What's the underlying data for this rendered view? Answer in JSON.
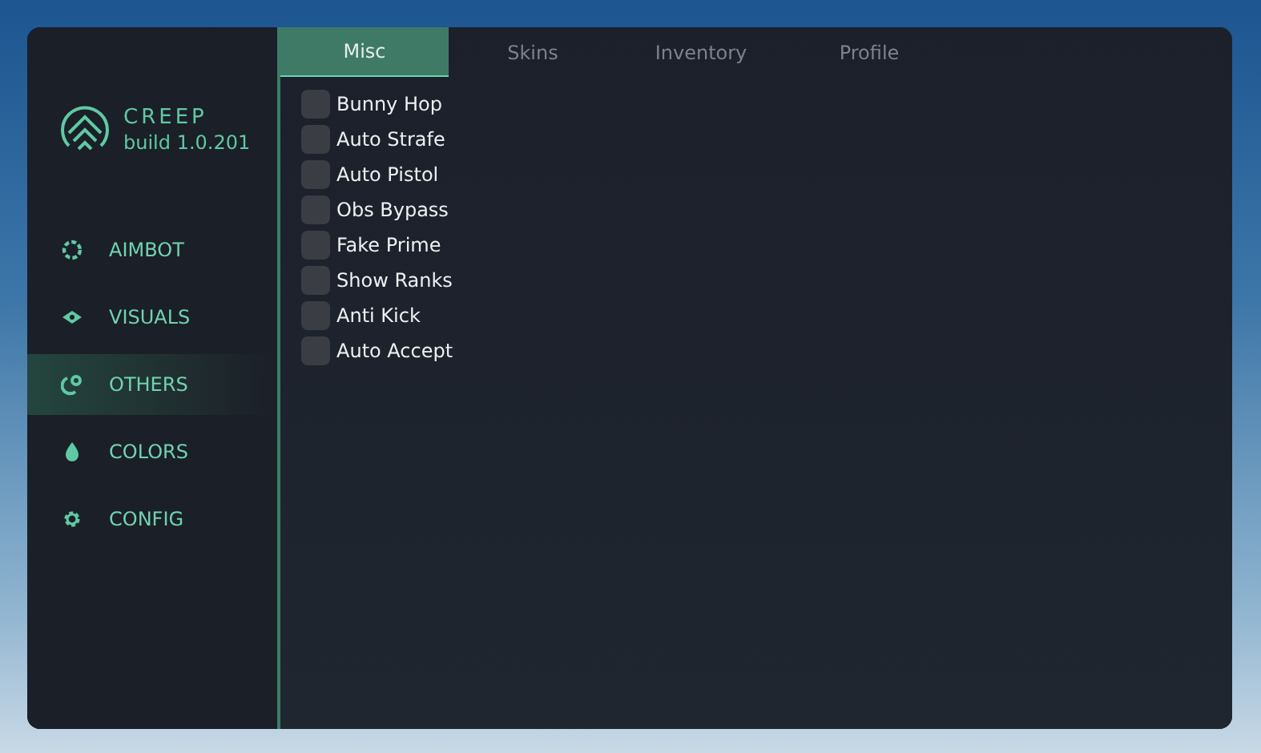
{
  "brand": {
    "name": "CREEP",
    "build": "build 1.0.201"
  },
  "sidebar": {
    "items": [
      {
        "label": "AIMBOT",
        "kind": "crosshair",
        "selected": false
      },
      {
        "label": "VISUALS",
        "kind": "eye",
        "selected": false
      },
      {
        "label": "OTHERS",
        "kind": "others",
        "selected": true
      },
      {
        "label": "COLORS",
        "kind": "drop",
        "selected": false
      },
      {
        "label": "CONFIG",
        "kind": "gear",
        "selected": false
      }
    ]
  },
  "tabs": [
    {
      "label": "Misc",
      "selected": true
    },
    {
      "label": "Skins",
      "selected": false
    },
    {
      "label": "Inventory",
      "selected": false
    },
    {
      "label": "Profile",
      "selected": false
    }
  ],
  "options": [
    {
      "label": "Bunny Hop",
      "checked": false
    },
    {
      "label": "Auto Strafe",
      "checked": false
    },
    {
      "label": "Auto Pistol",
      "checked": false
    },
    {
      "label": "Obs Bypass",
      "checked": false
    },
    {
      "label": "Fake Prime",
      "checked": false
    },
    {
      "label": "Show Ranks",
      "checked": false
    },
    {
      "label": "Anti Kick",
      "checked": false
    },
    {
      "label": "Auto Accept",
      "checked": false
    }
  ]
}
